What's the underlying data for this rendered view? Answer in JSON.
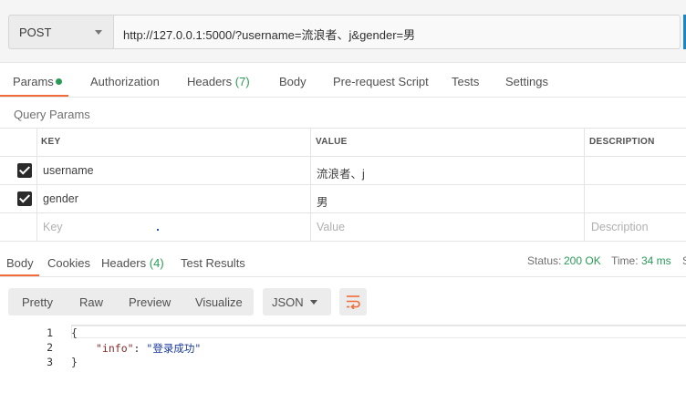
{
  "request": {
    "method": "POST",
    "url": "http://127.0.0.1:5000/?username=流浪者、j&gender=男"
  },
  "request_tabs": [
    {
      "label": "Params",
      "count": ""
    },
    {
      "label": "Authorization",
      "count": ""
    },
    {
      "label": "Headers",
      "count": "(7)"
    },
    {
      "label": "Body",
      "count": ""
    },
    {
      "label": "Pre-request Script",
      "count": ""
    },
    {
      "label": "Tests",
      "count": ""
    },
    {
      "label": "Settings",
      "count": ""
    }
  ],
  "query_params": {
    "title": "Query Params",
    "headers": {
      "key": "KEY",
      "value": "VALUE",
      "description": "DESCRIPTION"
    },
    "rows": [
      {
        "checked": true,
        "key": "username",
        "value": "流浪者、j",
        "description": ""
      },
      {
        "checked": true,
        "key": "gender",
        "value": "男",
        "description": ""
      }
    ],
    "placeholders": {
      "key": "Key",
      "value": "Value",
      "description": "Description"
    }
  },
  "response_tabs": [
    {
      "label": "Body",
      "count": ""
    },
    {
      "label": "Cookies",
      "count": ""
    },
    {
      "label": "Headers",
      "count": "(4)"
    },
    {
      "label": "Test Results",
      "count": ""
    }
  ],
  "status": {
    "status_label": "Status:",
    "status_value": "200 OK",
    "time_label": "Time:",
    "time_value": "34 ms",
    "size_label_fragment": "S"
  },
  "view_modes": [
    "Pretty",
    "Raw",
    "Preview",
    "Visualize"
  ],
  "format": "JSON",
  "code": {
    "line_numbers": [
      "1",
      "2",
      "3"
    ],
    "open_brace": "{",
    "key": "\"info\"",
    "colon": ": ",
    "value": "\"登录成功\"",
    "close_brace": "}"
  },
  "colors": {
    "accent": "#f26b3a",
    "success": "#2b9a57",
    "send": "#1a86c8"
  },
  "icons": [
    "chevron-down-icon",
    "checkbox-checked-icon",
    "wrap-lines-icon"
  ]
}
